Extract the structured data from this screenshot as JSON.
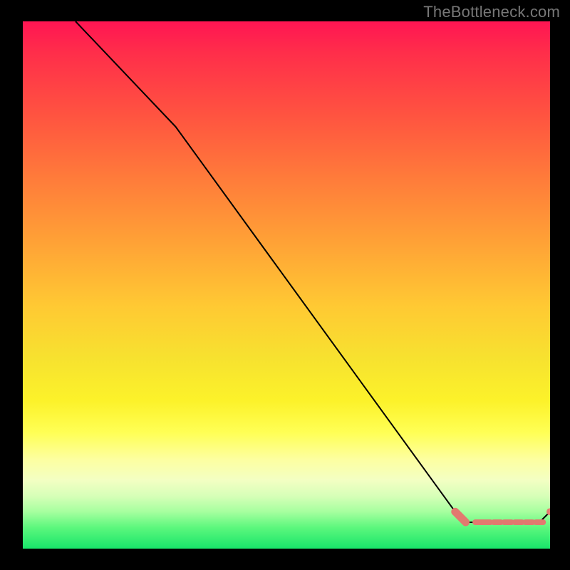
{
  "watermark": "TheBottleneck.com",
  "colors": {
    "page_bg": "#000000",
    "watermark": "#777777",
    "series_line": "#000000",
    "marker_fill": "#e2796f",
    "marker_stroke": "#e2796f",
    "gradient_top": "#ff1553",
    "gradient_bottom": "#18e56a"
  },
  "chart_data": {
    "type": "line",
    "title": "",
    "xlabel": "",
    "ylabel": "",
    "xlim": [
      0,
      100
    ],
    "ylim": [
      0,
      100
    ],
    "grid": false,
    "series": [
      {
        "name": "curve",
        "style": "solid",
        "color": "#000000",
        "x": [
          10,
          29,
          82,
          84,
          98,
          100
        ],
        "y": [
          100,
          80,
          7,
          5,
          5,
          7
        ]
      },
      {
        "name": "flat-segment-markers",
        "style": "markers-dashed",
        "color": "#e2796f",
        "x": [
          82,
          84,
          86.5,
          88,
          90,
          92,
          94,
          96,
          98,
          100
        ],
        "y": [
          7,
          5,
          5,
          5,
          5,
          5,
          5,
          5,
          5,
          7
        ]
      }
    ],
    "annotations": []
  }
}
